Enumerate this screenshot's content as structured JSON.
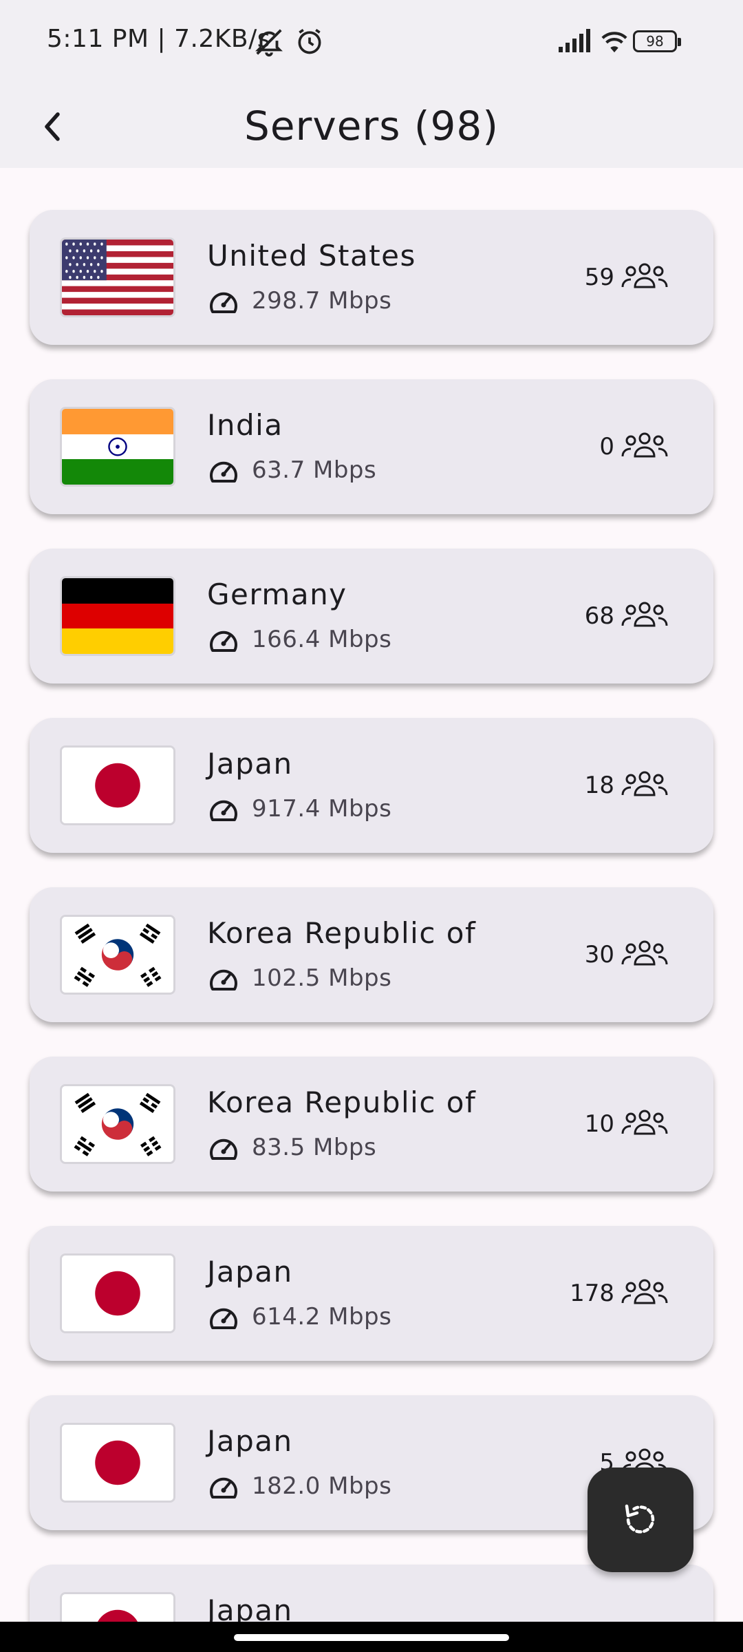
{
  "status_bar": {
    "time": "5:11 PM | 7.2KB/s",
    "battery": "98",
    "icons": [
      "bell-off-icon",
      "alarm-icon",
      "signal-icon",
      "wifi-icon",
      "battery-icon"
    ]
  },
  "header": {
    "title": "Servers (98)",
    "back_icon": "back-arrow-icon"
  },
  "servers": [
    {
      "country": "United States",
      "speed": "298.7 Mbps",
      "users": "59",
      "flag": "us"
    },
    {
      "country": "India",
      "speed": "63.7 Mbps",
      "users": "0",
      "flag": "in"
    },
    {
      "country": "Germany",
      "speed": "166.4 Mbps",
      "users": "68",
      "flag": "de"
    },
    {
      "country": "Japan",
      "speed": "917.4 Mbps",
      "users": "18",
      "flag": "jp"
    },
    {
      "country": "Korea Republic of",
      "speed": "102.5 Mbps",
      "users": "30",
      "flag": "kr"
    },
    {
      "country": "Korea Republic of",
      "speed": "83.5 Mbps",
      "users": "10",
      "flag": "kr"
    },
    {
      "country": "Japan",
      "speed": "614.2 Mbps",
      "users": "178",
      "flag": "jp"
    },
    {
      "country": "Japan",
      "speed": "182.0 Mbps",
      "users": "5",
      "flag": "jp"
    },
    {
      "country": "Japan",
      "speed": "",
      "users": "",
      "flag": "jp"
    }
  ],
  "fab": {
    "icon": "refresh-icon"
  },
  "colors": {
    "background": "#fdf8fb",
    "card": "#ebe8ef",
    "app_bar": "#f1eff3",
    "fab": "#2b2b2b"
  }
}
